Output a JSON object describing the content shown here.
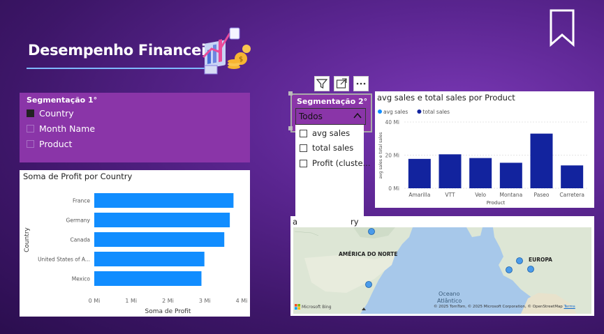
{
  "header": {
    "title": "Desempenho Financeiro"
  },
  "seg1": {
    "title": "Segmentação 1°",
    "items": [
      {
        "label": "Country",
        "checked": true
      },
      {
        "label": "Month Name",
        "checked": false
      },
      {
        "label": "Product",
        "checked": false
      }
    ]
  },
  "seg2": {
    "title": "Segmentação 2°",
    "selected": "Todos",
    "items": [
      {
        "label": "avg sales"
      },
      {
        "label": "total sales"
      },
      {
        "label": "Profit (cluste..."
      }
    ]
  },
  "visual_header": {
    "icons": [
      "filter-icon",
      "focus-mode-icon",
      "more-options-icon"
    ]
  },
  "profit_chart": {
    "title": "Soma de Profit por Country",
    "chart_data": {
      "type": "bar",
      "orientation": "horizontal",
      "title": "Soma de Profit por Country",
      "xlabel": "Soma de Profit",
      "ylabel": "Country",
      "categories": [
        "France",
        "Germany",
        "Canada",
        "United States of A...",
        "Mexico"
      ],
      "values": [
        3.78,
        3.68,
        3.53,
        2.99,
        2.91
      ],
      "xticks": [
        "0 Mi",
        "1 Mi",
        "2 Mi",
        "3 Mi",
        "4 Mi"
      ],
      "xlim": [
        0,
        4
      ],
      "color": "#118dff"
    }
  },
  "avg_chart": {
    "title": "avg sales e total sales por Product",
    "chart_data": {
      "type": "bar",
      "title": "avg sales e total sales por Product",
      "xlabel": "Product",
      "ylabel": "avg sales e total sales",
      "categories": [
        "Amarilla",
        "VTT",
        "Velo",
        "Montana",
        "Paseo",
        "Carretera"
      ],
      "series": [
        {
          "name": "avg sales",
          "color": "#118dff",
          "values": []
        },
        {
          "name": "total sales",
          "color": "#12239e",
          "values": [
            17.75,
            20.5,
            18.25,
            15.4,
            33.0,
            13.8
          ]
        }
      ],
      "yticks": [
        "0 Mi",
        "20 Mi",
        "40 Mi"
      ],
      "ylim": [
        0,
        40
      ]
    }
  },
  "map": {
    "title_visible": "a",
    "title_visible2": "ry",
    "labels": {
      "na": "AMÉRICA DO NORTE",
      "eu": "EUROPA",
      "ocean1": "Oceano",
      "ocean2": "Atlântico"
    },
    "brand": "Microsoft Bing",
    "attribution": "© 2025 TomTom, © 2025 Microsoft Corporation, © OpenStreetMap",
    "terms": "Terms",
    "point_color": "#4a9bea"
  }
}
